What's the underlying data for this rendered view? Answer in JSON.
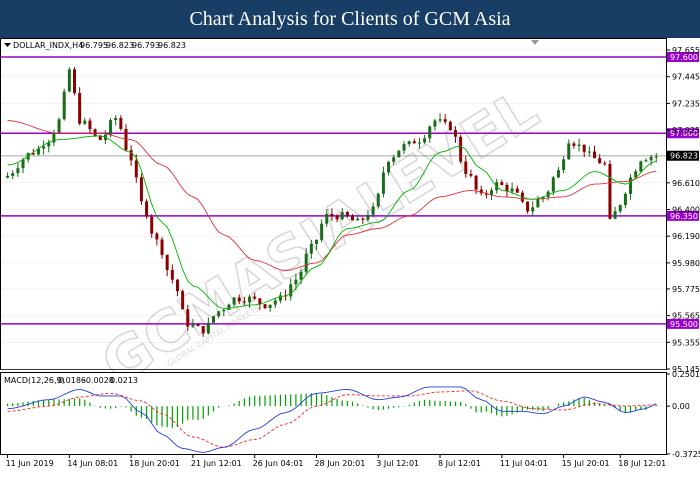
{
  "banner": {
    "title": "Chart Analysis for Clients of GCM Asia"
  },
  "colors": {
    "frame": "#000000",
    "grid": "#e6e6e6",
    "bull": "#1a6b1a",
    "bear": "#8b0000",
    "ma_fast": "#00b400",
    "ma_slow": "#e0303a",
    "level": "#9900cc",
    "current": "#000000",
    "current_line": "#b4b4b4",
    "macd_hist": "#00a000",
    "macd_line": "#1f3fe0",
    "macd_signal": "#ff2020"
  },
  "chart_data": [
    {
      "type": "candlestick",
      "header": "DOLLAR_INDX,H4  96.795 96.823 96.793 96.823",
      "symbol": "DOLLAR_INDX,H4",
      "ohlc_header": [
        "96.795",
        "96.823",
        "96.793",
        "96.823"
      ],
      "watermark": "GCMASIALEVEL",
      "watermark_sub": "GLOBAL CAPITAL MARKETS",
      "ylim": [
        95.145,
        97.655
      ],
      "yticks": [
        "97.655",
        "97.445",
        "97.235",
        "97.025",
        "96.815",
        "96.610",
        "96.400",
        "96.190",
        "95.980",
        "95.775",
        "95.565",
        "95.355",
        "95.145"
      ],
      "levels": [
        {
          "value": 97.6,
          "label": "97.600"
        },
        {
          "value": 97.0,
          "label": "97.000"
        },
        {
          "value": 96.35,
          "label": "96.350"
        },
        {
          "value": 95.5,
          "label": "95.500"
        }
      ],
      "current": {
        "value": 96.823,
        "label": "96.823"
      },
      "x_labels": [
        "11 Jun 2019",
        "14 Jun 08:01",
        "18 Jun 20:01",
        "21 Jun 12:01",
        "26 Jun 04:01",
        "28 Jun 20:01",
        "3 Jul 12:01",
        "8 Jul 12:01",
        "11 Jul 04:01",
        "15 Jul 20:01",
        "18 Jul 12:01"
      ],
      "x_label_index": [
        0,
        12,
        24,
        36,
        48,
        60,
        72,
        84,
        96,
        108,
        119
      ],
      "path_knots": [
        [
          0,
          96.65
        ],
        [
          6,
          96.85
        ],
        [
          9,
          96.95
        ],
        [
          11,
          97.1
        ],
        [
          13,
          97.5
        ],
        [
          15,
          97.1
        ],
        [
          19,
          96.95
        ],
        [
          22,
          97.12
        ],
        [
          25,
          96.8
        ],
        [
          27,
          96.45
        ],
        [
          30,
          96.15
        ],
        [
          33,
          95.85
        ],
        [
          36,
          95.5
        ],
        [
          39,
          95.45
        ],
        [
          42,
          95.6
        ],
        [
          45,
          95.7
        ],
        [
          48,
          95.7
        ],
        [
          51,
          95.65
        ],
        [
          54,
          95.7
        ],
        [
          57,
          95.85
        ],
        [
          60,
          96.1
        ],
        [
          63,
          96.35
        ],
        [
          66,
          96.35
        ],
        [
          69,
          96.3
        ],
        [
          72,
          96.4
        ],
        [
          75,
          96.8
        ],
        [
          78,
          96.9
        ],
        [
          81,
          96.95
        ],
        [
          84,
          97.1
        ],
        [
          87,
          97.05
        ],
        [
          90,
          96.7
        ],
        [
          93,
          96.5
        ],
        [
          96,
          96.6
        ],
        [
          99,
          96.55
        ],
        [
          102,
          96.4
        ],
        [
          105,
          96.5
        ],
        [
          108,
          96.7
        ],
        [
          110,
          96.95
        ],
        [
          112,
          96.9
        ],
        [
          115,
          96.8
        ],
        [
          117,
          96.75
        ],
        [
          118,
          96.3
        ],
        [
          120,
          96.45
        ],
        [
          122,
          96.65
        ],
        [
          124,
          96.8
        ],
        [
          126,
          96.82
        ]
      ],
      "ma_fast_knots": [
        [
          0,
          96.75
        ],
        [
          10,
          96.95
        ],
        [
          18,
          96.98
        ],
        [
          24,
          96.85
        ],
        [
          30,
          96.3
        ],
        [
          36,
          95.8
        ],
        [
          42,
          95.62
        ],
        [
          48,
          95.65
        ],
        [
          54,
          95.72
        ],
        [
          60,
          95.95
        ],
        [
          66,
          96.25
        ],
        [
          72,
          96.3
        ],
        [
          78,
          96.55
        ],
        [
          84,
          96.85
        ],
        [
          88,
          96.9
        ],
        [
          92,
          96.72
        ],
        [
          96,
          96.55
        ],
        [
          102,
          96.48
        ],
        [
          108,
          96.55
        ],
        [
          114,
          96.7
        ],
        [
          120,
          96.6
        ],
        [
          126,
          96.78
        ]
      ],
      "ma_slow_knots": [
        [
          0,
          97.1
        ],
        [
          10,
          97.0
        ],
        [
          18,
          97.0
        ],
        [
          24,
          96.95
        ],
        [
          30,
          96.75
        ],
        [
          36,
          96.5
        ],
        [
          42,
          96.2
        ],
        [
          48,
          96.0
        ],
        [
          54,
          95.92
        ],
        [
          60,
          95.98
        ],
        [
          66,
          96.2
        ],
        [
          72,
          96.25
        ],
        [
          78,
          96.35
        ],
        [
          84,
          96.5
        ],
        [
          90,
          96.55
        ],
        [
          96,
          96.5
        ],
        [
          102,
          96.48
        ],
        [
          108,
          96.5
        ],
        [
          114,
          96.6
        ],
        [
          120,
          96.62
        ],
        [
          126,
          96.7
        ]
      ]
    },
    {
      "type": "macd",
      "header": "MACD(12,26,9)  0.0186  -0.0028  0.0213",
      "params": "MACD(12,26,9)",
      "values_header": [
        "0.0186",
        "-0.0028",
        "0.0213"
      ],
      "ylim": [
        -0.3725,
        0.2501
      ],
      "yticks": [
        {
          "value": 0.2501,
          "label": "0.2501"
        },
        {
          "value": 0.0,
          "label": "0.00"
        },
        {
          "value": -0.3725,
          "label": "-0.3725"
        }
      ],
      "line_knots": [
        [
          0,
          -0.02
        ],
        [
          8,
          0.05
        ],
        [
          14,
          0.13
        ],
        [
          18,
          0.08
        ],
        [
          22,
          0.08
        ],
        [
          26,
          -0.05
        ],
        [
          30,
          -0.22
        ],
        [
          34,
          -0.33
        ],
        [
          38,
          -0.36
        ],
        [
          42,
          -0.32
        ],
        [
          48,
          -0.18
        ],
        [
          54,
          -0.05
        ],
        [
          60,
          0.1
        ],
        [
          66,
          0.13
        ],
        [
          72,
          0.05
        ],
        [
          76,
          0.07
        ],
        [
          82,
          0.15
        ],
        [
          88,
          0.15
        ],
        [
          92,
          0.05
        ],
        [
          96,
          -0.04
        ],
        [
          100,
          -0.04
        ],
        [
          104,
          -0.06
        ],
        [
          108,
          0.0
        ],
        [
          112,
          0.07
        ],
        [
          116,
          0.03
        ],
        [
          120,
          -0.05
        ],
        [
          124,
          -0.02
        ],
        [
          126,
          0.02
        ]
      ],
      "signal_knots": [
        [
          0,
          -0.04
        ],
        [
          8,
          0.0
        ],
        [
          14,
          0.07
        ],
        [
          20,
          0.1
        ],
        [
          26,
          0.04
        ],
        [
          30,
          -0.06
        ],
        [
          36,
          -0.24
        ],
        [
          42,
          -0.32
        ],
        [
          48,
          -0.26
        ],
        [
          54,
          -0.14
        ],
        [
          60,
          0.0
        ],
        [
          66,
          0.09
        ],
        [
          72,
          0.08
        ],
        [
          78,
          0.08
        ],
        [
          84,
          0.11
        ],
        [
          90,
          0.12
        ],
        [
          96,
          0.04
        ],
        [
          102,
          -0.02
        ],
        [
          108,
          -0.03
        ],
        [
          114,
          0.02
        ],
        [
          120,
          0.0
        ],
        [
          126,
          0.01
        ]
      ]
    }
  ]
}
